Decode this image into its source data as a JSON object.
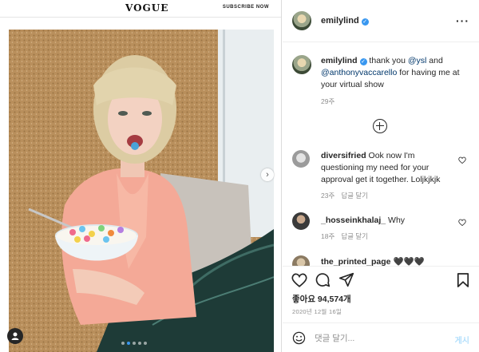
{
  "site": {
    "logo": "VOGUE",
    "subscribe": "SUBSCRIBE NOW"
  },
  "post": {
    "username": "emilylind",
    "more_icon": "more-horizontal-icon",
    "caption": {
      "username": "emilylind",
      "text_1": " thank you ",
      "mention_1": "@ysl",
      "text_2": " and ",
      "mention_2": "@anthonyvaccarello",
      "text_3": " for having me at your virtual show",
      "time": "29주"
    },
    "load_more_icon": "plus-circle-icon",
    "comments": [
      {
        "username": "diversifried",
        "text": " Ook now I'm questioning my need for your approval get it together. Loljkjkjk",
        "time": "23주",
        "reply": "답글 달기"
      },
      {
        "username": "_hosseinkhalaj_",
        "text": " Why",
        "time": "18주",
        "reply": "답글 달기"
      },
      {
        "username": "the_printed_page",
        "text": " 🖤🖤🖤",
        "time": "",
        "reply": ""
      }
    ],
    "likes": "좋아요 94,574개",
    "date": "2020년 12월 16일",
    "comment_placeholder": "댓글 달기...",
    "post_button": "게시"
  },
  "carousel": {
    "slide_count": 5,
    "active_index": 1
  },
  "colors": {
    "accent": "#3897f0",
    "link": "#00376b",
    "muted": "#8e8e8e",
    "post_disabled": "#b2dffc"
  }
}
